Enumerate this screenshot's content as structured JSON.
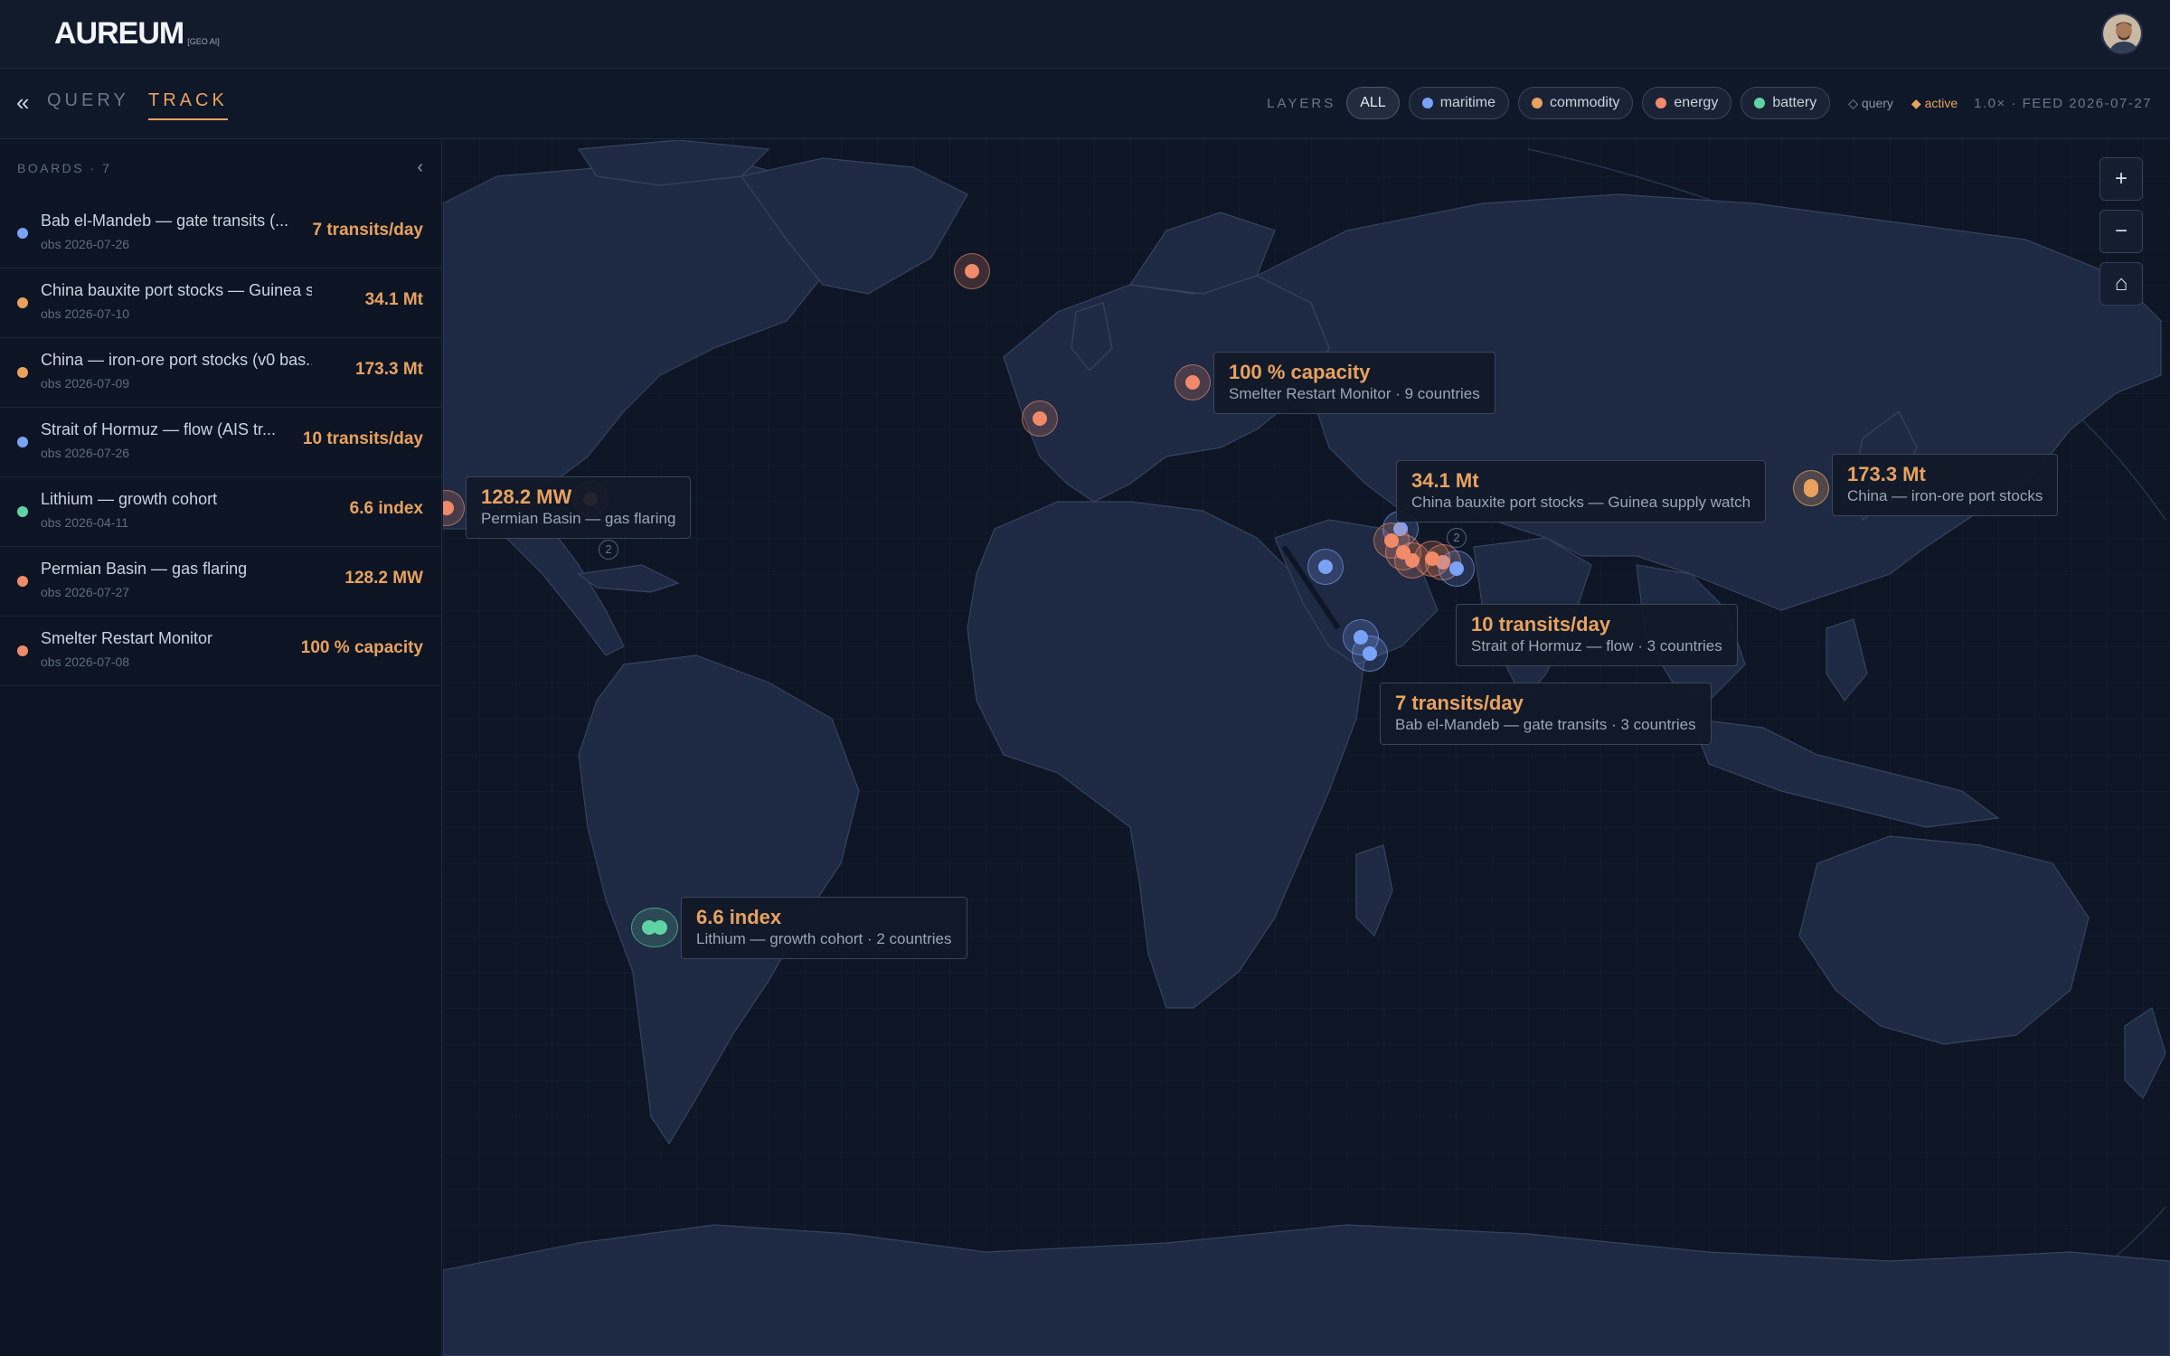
{
  "app": {
    "logo": "AUREUM",
    "logo_sub": "[GEO AI]"
  },
  "header": {
    "avatar": "user-avatar"
  },
  "nav": {
    "collapse": "«",
    "tabs": [
      "QUERY",
      "TRACK"
    ],
    "active_tab": "TRACK"
  },
  "layers": {
    "label": "LAYERS",
    "chips": [
      {
        "label": "ALL",
        "color": ""
      },
      {
        "label": "maritime",
        "color": "#7aa2f7"
      },
      {
        "label": "commodity",
        "color": "#e8a25e"
      },
      {
        "label": "energy",
        "color": "#f08a6a"
      },
      {
        "label": "battery",
        "color": "#5fd3a4"
      }
    ],
    "legend_query": "◇ query",
    "legend_active": "◆ active",
    "feed": "1.0× · FEED 2026-07-27"
  },
  "sidebar": {
    "title": "BOARDS · 7",
    "collapse": "‹",
    "items": [
      {
        "name": "Bab el-Mandeb — gate transits (...",
        "date": "obs 2026-07-26",
        "value": "7 transits/day",
        "color": "#7aa2f7"
      },
      {
        "name": "China bauxite port stocks — Guinea su...",
        "date": "obs 2026-07-10",
        "value": "34.1 Mt",
        "color": "#e8a25e"
      },
      {
        "name": "China — iron-ore port stocks (v0 bas...",
        "date": "obs 2026-07-09",
        "value": "173.3 Mt",
        "color": "#e8a25e"
      },
      {
        "name": "Strait of Hormuz — flow (AIS tr...",
        "date": "obs 2026-07-26",
        "value": "10 transits/day",
        "color": "#7aa2f7"
      },
      {
        "name": "Lithium — growth cohort",
        "date": "obs 2026-04-11",
        "value": "6.6 index",
        "color": "#5fd3a4"
      },
      {
        "name": "Permian Basin — gas flaring",
        "date": "obs 2026-07-27",
        "value": "128.2 MW",
        "color": "#f08a6a"
      },
      {
        "name": "Smelter Restart Monitor",
        "date": "obs 2026-07-08",
        "value": "100 % capacity",
        "color": "#f08a6a"
      }
    ]
  },
  "map": {
    "callouts": [
      {
        "value": "100 % capacity",
        "sub": "Smelter Restart Monitor · 9 countries"
      },
      {
        "value": "34.1 Mt",
        "sub": "China bauxite port stocks — Guinea supply watch"
      },
      {
        "value": "173.3 Mt",
        "sub": "China — iron-ore port stocks"
      },
      {
        "value": "128.2 MW",
        "sub": "Permian Basin — gas flaring"
      },
      {
        "value": "10 transits/day",
        "sub": "Strait of Hormuz — flow · 3 countries"
      },
      {
        "value": "7 transits/day",
        "sub": "Bab el-Mandeb — gate transits · 3 countries"
      },
      {
        "value": "6.6 index",
        "sub": "Lithium — growth cohort · 2 countries"
      }
    ],
    "cluster_counts": [
      "2",
      "2"
    ],
    "zoom": {
      "in": "+",
      "out": "−",
      "home": "⌂"
    }
  },
  "colors": {
    "maritime": "#7aa2f7",
    "commodity": "#e8a25e",
    "energy": "#f08a6a",
    "battery": "#5fd3a4",
    "accent": "#e8a25e"
  }
}
